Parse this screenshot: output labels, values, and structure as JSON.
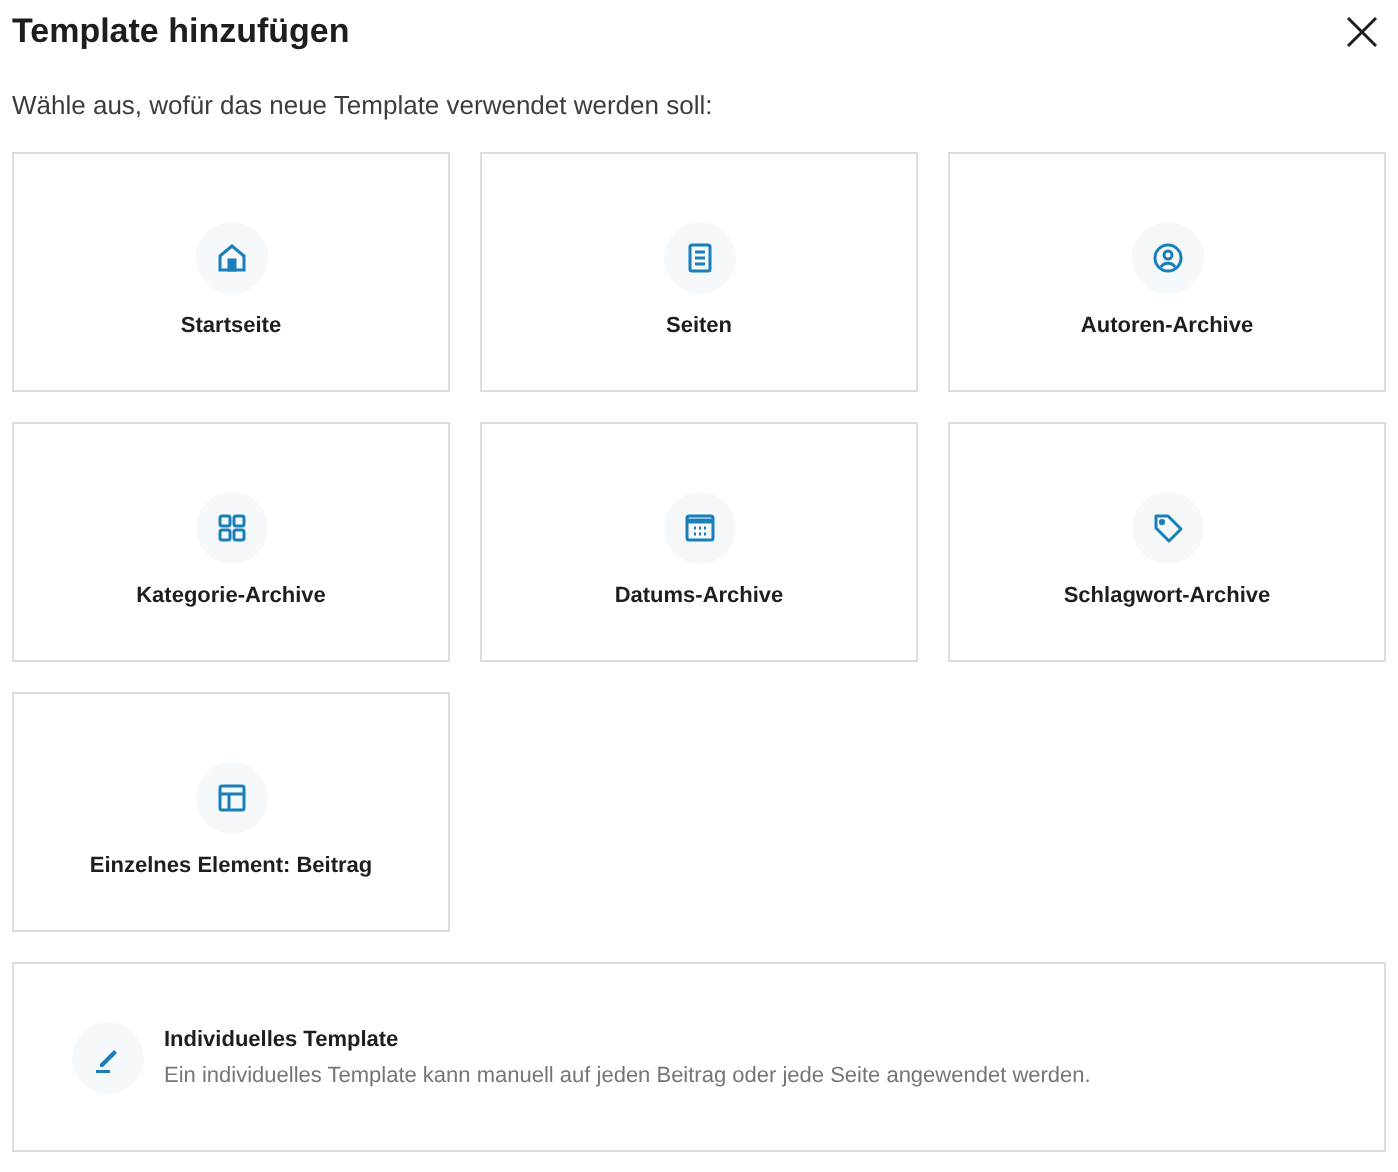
{
  "dialog": {
    "title": "Template hinzufügen",
    "subtitle": "Wähle aus, wofür das neue Template verwendet werden soll:"
  },
  "templates": [
    {
      "kind": "home",
      "label": "Startseite"
    },
    {
      "kind": "page",
      "label": "Seiten"
    },
    {
      "kind": "user",
      "label": "Autoren-Archive"
    },
    {
      "kind": "grid",
      "label": "Kategorie-Archive"
    },
    {
      "kind": "calendar",
      "label": "Datums-Archive"
    },
    {
      "kind": "tag",
      "label": "Schlagwort-Archive"
    },
    {
      "kind": "layout",
      "label": "Einzelnes Element: Beitrag"
    }
  ],
  "custom": {
    "kind": "pencil",
    "title": "Individuelles Template",
    "description": "Ein individuelles Template kann manuell auf jeden Beitrag oder jede Seite angewendet werden."
  }
}
